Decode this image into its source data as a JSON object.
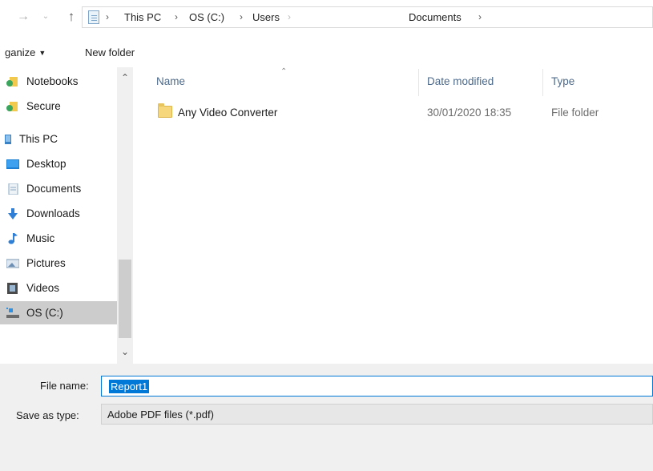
{
  "address_bar": {
    "crumbs": [
      "This PC",
      "OS (C:)",
      "Users",
      "Documents"
    ]
  },
  "toolbar": {
    "organize_label": "ganize",
    "new_folder_label": "New folder"
  },
  "sidebar": {
    "items": [
      {
        "label": "Notebooks",
        "icon": "onenote-notebook-icon"
      },
      {
        "label": "Secure",
        "icon": "onenote-notebook-icon"
      },
      {
        "label": "This PC",
        "icon": "computer-icon"
      },
      {
        "label": "Desktop",
        "icon": "desktop-icon"
      },
      {
        "label": "Documents",
        "icon": "documents-icon"
      },
      {
        "label": "Downloads",
        "icon": "downloads-arrow-icon"
      },
      {
        "label": "Music",
        "icon": "music-note-icon"
      },
      {
        "label": "Pictures",
        "icon": "pictures-icon"
      },
      {
        "label": "Videos",
        "icon": "videos-icon"
      },
      {
        "label": "OS (C:)",
        "icon": "drive-icon",
        "selected": true
      }
    ]
  },
  "file_list": {
    "columns": {
      "name": "Name",
      "date": "Date modified",
      "type": "Type"
    },
    "rows": [
      {
        "name": "Any Video Converter",
        "date": "30/01/2020 18:35",
        "type": "File folder",
        "icon": "folder-icon"
      }
    ]
  },
  "save_panel": {
    "file_name_label": "File name:",
    "file_name_value": "Report1",
    "save_as_type_label": "Save as type:",
    "save_as_type_value": "Adobe PDF files (*.pdf)"
  },
  "colors": {
    "selection_blue": "#0078d7",
    "sidebar_selected": "#cccccc",
    "panel_bg": "#f0f0f0",
    "column_header": "#4d6a8a"
  }
}
